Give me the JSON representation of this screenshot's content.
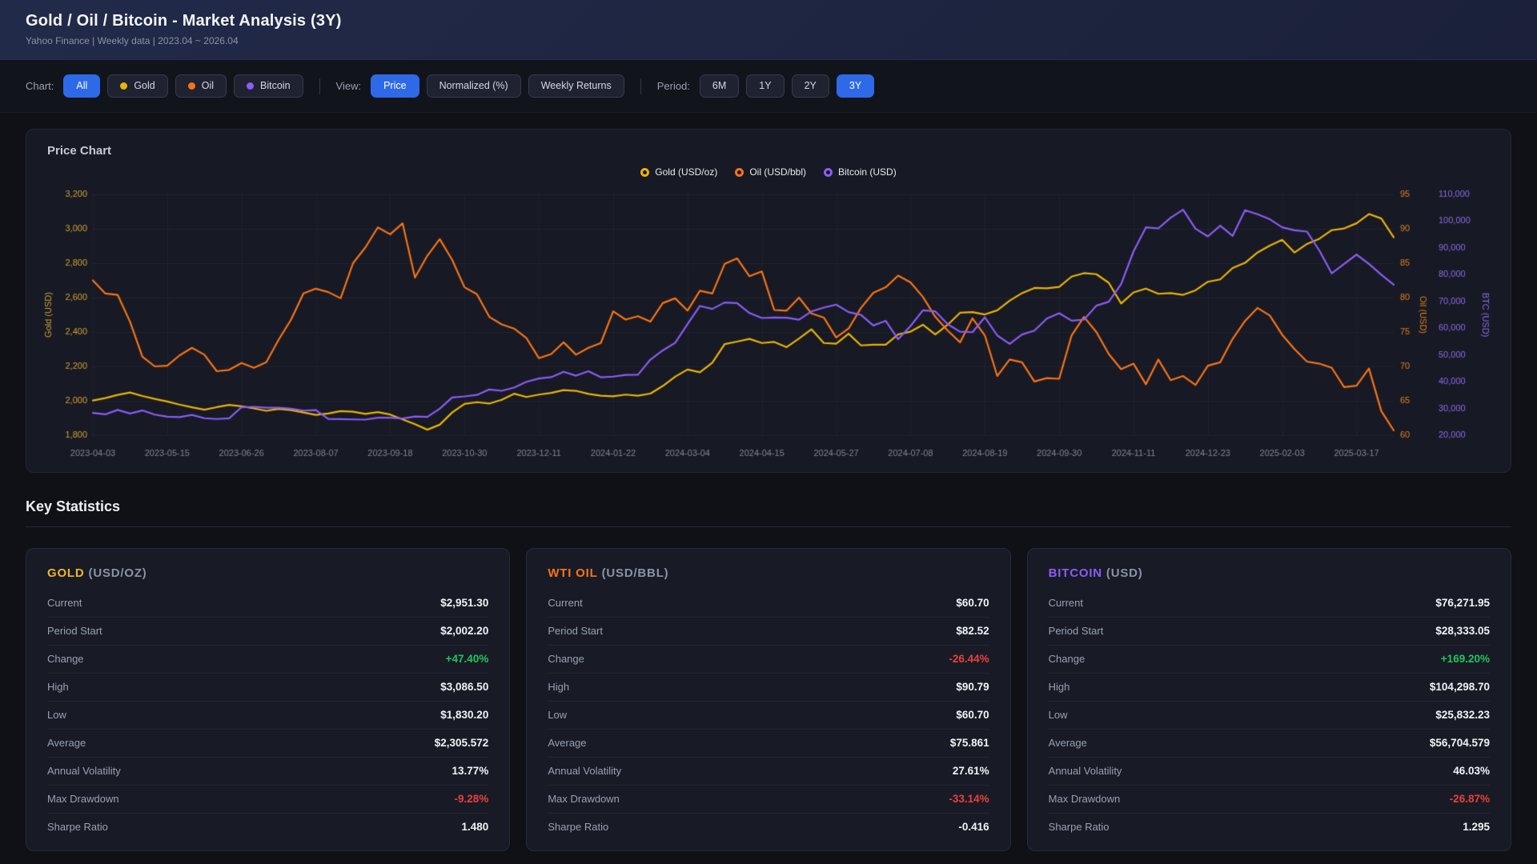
{
  "header": {
    "title": "Gold / Oil / Bitcoin - Market Analysis (3Y)",
    "subtitle": "Yahoo Finance | Weekly data | 2023.04 ~ 2026.04"
  },
  "toolbar": {
    "chart_label": "Chart:",
    "chart_buttons": [
      {
        "label": "All",
        "active": true
      },
      {
        "label": "Gold",
        "dot": "#eab308"
      },
      {
        "label": "Oil",
        "dot": "#f97316"
      },
      {
        "label": "Bitcoin",
        "dot": "#8b5cf6"
      }
    ],
    "view_label": "View:",
    "view_buttons": [
      {
        "label": "Price",
        "active": true
      },
      {
        "label": "Normalized (%)"
      },
      {
        "label": "Weekly Returns"
      }
    ],
    "period_label": "Period:",
    "period_buttons": [
      {
        "label": "6M"
      },
      {
        "label": "1Y"
      },
      {
        "label": "2Y"
      },
      {
        "label": "3Y",
        "active": true
      }
    ]
  },
  "chart_data": {
    "type": "line",
    "title": "Price Chart",
    "grid": true,
    "legend_position": "top-center",
    "x_tick_every": 6,
    "x_tick_labels": [
      "2023-04-03",
      "2023-05-15",
      "2023-06-26",
      "2023-08-07",
      "2023-09-18",
      "2023-10-30",
      "2023-12-11",
      "2024-01-22",
      "2024-03-04",
      "2024-04-15",
      "2024-05-27",
      "2024-07-08",
      "2024-08-19",
      "2024-09-30",
      "2024-11-11",
      "2024-12-23",
      "2025-02-03",
      "2025-03-17"
    ],
    "axes": {
      "gold": {
        "label": "Gold (USD)",
        "min": 1800,
        "max": 3200,
        "color": "#cfa233",
        "ticks": [
          "3,200",
          "3,000",
          "2,800",
          "2,600",
          "2,400",
          "2,200",
          "2,000",
          "1,800"
        ]
      },
      "oil": {
        "label": "Oil (USD)",
        "min": 60,
        "max": 95,
        "color": "#e07f1f",
        "ticks": [
          "95",
          "90",
          "85",
          "80",
          "75",
          "70",
          "65",
          "60"
        ]
      },
      "btc": {
        "label": "BTC (USD)",
        "min": 20000,
        "max": 110000,
        "color": "#8a6ceb",
        "ticks": [
          "110,000",
          "100,000",
          "90,000",
          "80,000",
          "70,000",
          "60,000",
          "50,000",
          "40,000",
          "30,000",
          "20,000"
        ]
      }
    },
    "series": [
      {
        "name": "Gold (USD/oz)",
        "axis": "gold",
        "color": "#eab308",
        "values": [
          2002,
          2016,
          2034,
          2048,
          2028,
          2011,
          1996,
          1978,
          1962,
          1948,
          1963,
          1976,
          1968,
          1956,
          1942,
          1953,
          1946,
          1932,
          1918,
          1926,
          1940,
          1937,
          1924,
          1934,
          1920,
          1892,
          1864,
          1832,
          1861,
          1932,
          1982,
          1992,
          1984,
          2006,
          2041,
          2022,
          2036,
          2046,
          2062,
          2058,
          2040,
          2030,
          2026,
          2036,
          2030,
          2042,
          2086,
          2140,
          2182,
          2166,
          2222,
          2330,
          2344,
          2360,
          2336,
          2342,
          2312,
          2362,
          2416,
          2336,
          2332,
          2390,
          2322,
          2326,
          2326,
          2386,
          2402,
          2442,
          2386,
          2442,
          2512,
          2516,
          2502,
          2526,
          2582,
          2626,
          2656,
          2654,
          2662,
          2722,
          2742,
          2736,
          2686,
          2566,
          2630,
          2652,
          2622,
          2626,
          2616,
          2642,
          2692,
          2706,
          2772,
          2802,
          2862,
          2902,
          2936,
          2862,
          2912,
          2942,
          2992,
          3002,
          3032,
          3086,
          3060,
          2951
        ]
      },
      {
        "name": "Oil (USD/bbl)",
        "axis": "oil",
        "color": "#f97316",
        "values": [
          82.5,
          80.6,
          80.4,
          76.5,
          71.4,
          70.0,
          70.1,
          71.6,
          72.7,
          71.7,
          69.3,
          69.5,
          70.5,
          69.8,
          70.6,
          73.9,
          76.8,
          80.6,
          81.3,
          80.8,
          79.9,
          85.0,
          87.3,
          90.2,
          89.2,
          90.8,
          82.9,
          86.1,
          88.5,
          85.5,
          81.5,
          80.5,
          77.2,
          76.1,
          75.5,
          74.1,
          71.2,
          71.8,
          73.5,
          71.7,
          72.7,
          73.4,
          78.0,
          76.8,
          77.3,
          76.5,
          79.2,
          79.9,
          78.1,
          81.0,
          80.6,
          84.9,
          85.7,
          83.1,
          83.8,
          78.2,
          78.1,
          80.0,
          77.7,
          77.1,
          74.2,
          75.5,
          78.5,
          80.7,
          81.5,
          83.2,
          82.2,
          80.1,
          77.2,
          75.2,
          73.5,
          77.0,
          74.5,
          68.6,
          71.0,
          70.6,
          67.8,
          68.3,
          68.2,
          74.5,
          77.2,
          75.0,
          71.8,
          69.6,
          70.4,
          67.4,
          71.0,
          68.0,
          68.6,
          67.3,
          70.1,
          70.6,
          74.0,
          76.6,
          78.5,
          77.4,
          74.6,
          72.5,
          70.7,
          70.4,
          69.8,
          67.0,
          67.2,
          69.7,
          63.5,
          60.7
        ]
      },
      {
        "name": "Bitcoin (USD)",
        "axis": "btc",
        "color": "#8b5cf6",
        "values": [
          28333,
          27800,
          29450,
          28100,
          29250,
          27700,
          26900,
          26750,
          27600,
          26350,
          26050,
          26330,
          30450,
          30620,
          30290,
          30250,
          29900,
          29200,
          29400,
          26100,
          26000,
          25900,
          25832,
          26550,
          26550,
          26250,
          27000,
          26850,
          29900,
          34100,
          34500,
          35050,
          37100,
          36600,
          37800,
          39950,
          41200,
          41700,
          43700,
          42250,
          43900,
          41650,
          41900,
          42550,
          42600,
          48250,
          51700,
          54500,
          61500,
          68300,
          67200,
          69600,
          69350,
          65650,
          63800,
          64000,
          63900,
          63150,
          66250,
          67700,
          68800,
          66000,
          64950,
          61000,
          62750,
          55850,
          60800,
          66700,
          66300,
          61500,
          58700,
          58500,
          64100,
          57300,
          54150,
          57650,
          59100,
          63600,
          65600,
          62800,
          63200,
          68400,
          69900,
          76500,
          88700,
          97700,
          97300,
          101300,
          104298,
          97200,
          94300,
          98300,
          94500,
          104100,
          102600,
          100700,
          97700,
          96600,
          96100,
          89000,
          80500,
          84000,
          87500,
          84000,
          80000,
          76272
        ]
      }
    ]
  },
  "stats": {
    "heading": "Key Statistics",
    "row_labels": [
      "Current",
      "Period Start",
      "Change",
      "High",
      "Low",
      "Average",
      "Annual Volatility",
      "Max Drawdown",
      "Sharpe Ratio"
    ],
    "cards": [
      {
        "symbol": "GOLD",
        "unit": "(USD/OZ)",
        "color": "#f0b429",
        "values": [
          {
            "text": "$2,951.30"
          },
          {
            "text": "$2,002.20"
          },
          {
            "text": "+47.40%",
            "tone": "up"
          },
          {
            "text": "$3,086.50"
          },
          {
            "text": "$1,830.20"
          },
          {
            "text": "$2,305.572"
          },
          {
            "text": "13.77%"
          },
          {
            "text": "-9.28%",
            "tone": "down"
          },
          {
            "text": "1.480"
          }
        ]
      },
      {
        "symbol": "WTI OIL",
        "unit": "(USD/BBL)",
        "color": "#f97316",
        "values": [
          {
            "text": "$60.70"
          },
          {
            "text": "$82.52"
          },
          {
            "text": "-26.44%",
            "tone": "down"
          },
          {
            "text": "$90.79"
          },
          {
            "text": "$60.70"
          },
          {
            "text": "$75.861"
          },
          {
            "text": "27.61%"
          },
          {
            "text": "-33.14%",
            "tone": "down"
          },
          {
            "text": "-0.416"
          }
        ]
      },
      {
        "symbol": "BITCOIN",
        "unit": "(USD)",
        "color": "#8b5cf6",
        "values": [
          {
            "text": "$76,271.95"
          },
          {
            "text": "$28,333.05"
          },
          {
            "text": "+169.20%",
            "tone": "up"
          },
          {
            "text": "$104,298.70"
          },
          {
            "text": "$25,832.23"
          },
          {
            "text": "$56,704.579"
          },
          {
            "text": "46.03%"
          },
          {
            "text": "-26.87%",
            "tone": "down"
          },
          {
            "text": "1.295"
          }
        ]
      }
    ]
  }
}
